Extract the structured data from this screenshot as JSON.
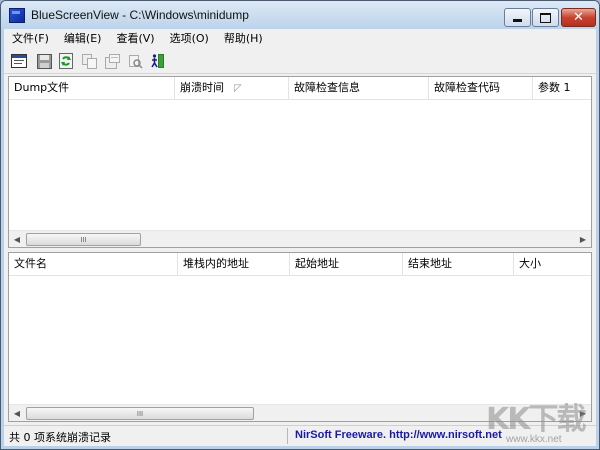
{
  "window": {
    "title": "BlueScreenView  -  C:\\Windows\\minidump"
  },
  "menubar": {
    "items": [
      {
        "label": "文件(F)"
      },
      {
        "label": "编辑(E)"
      },
      {
        "label": "查看(V)"
      },
      {
        "label": "选项(O)"
      },
      {
        "label": "帮助(H)"
      }
    ]
  },
  "toolbar": {
    "icons": [
      "properties-icon",
      "save-icon",
      "refresh-icon",
      "copy-icon",
      "advanced-options-icon",
      "find-icon",
      "exit-icon"
    ]
  },
  "top_table": {
    "columns": [
      {
        "label": "Dump文件"
      },
      {
        "label": "崩溃时间",
        "sort": "descending"
      },
      {
        "label": "故障检查信息"
      },
      {
        "label": "故障检查代码"
      },
      {
        "label": "参数 1"
      }
    ],
    "rows": [],
    "scrollbar_thumb_glyph": "III"
  },
  "bottom_table": {
    "columns": [
      {
        "label": "文件名"
      },
      {
        "label": "堆栈内的地址"
      },
      {
        "label": "起始地址"
      },
      {
        "label": "结束地址"
      },
      {
        "label": "大小"
      }
    ],
    "rows": [],
    "scrollbar_thumb_glyph": "III"
  },
  "statusbar": {
    "left": "共 0 项系统崩溃记录",
    "right": "NirSoft Freeware.  http://www.nirsoft.net"
  },
  "watermark": {
    "logo": "KK下载",
    "url": "www.kkx.net"
  }
}
